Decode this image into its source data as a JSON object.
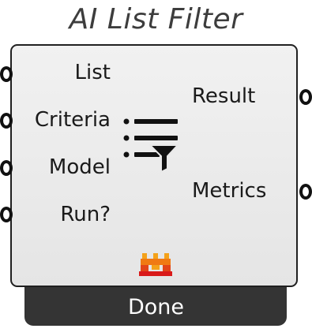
{
  "component": {
    "title": "AI List Filter",
    "inputs": [
      {
        "label": "List"
      },
      {
        "label": "Criteria"
      },
      {
        "label": "Model"
      },
      {
        "label": "Run?"
      }
    ],
    "outputs": [
      {
        "label": "Result"
      },
      {
        "label": "Metrics"
      }
    ],
    "status": "Done",
    "icons": {
      "center": "filter-list-icon",
      "plugin": "plugin-logo-icon"
    }
  },
  "colors": {
    "body": "#e9e9e9",
    "outline": "#202020",
    "status_bar": "#343434",
    "plugin_logo_top": "#f4a21a",
    "plugin_logo_bottom": "#d91a1a"
  }
}
